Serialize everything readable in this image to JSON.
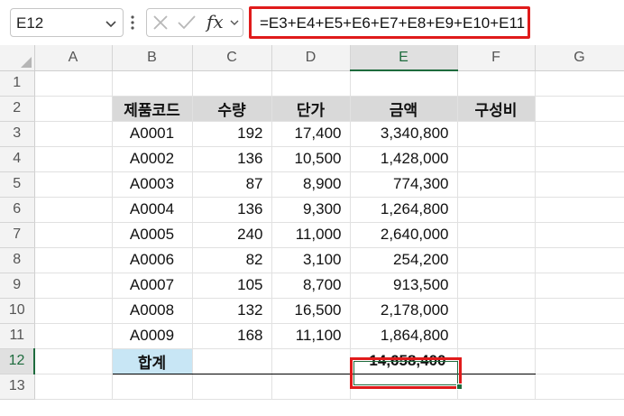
{
  "namebox": {
    "value": "E12"
  },
  "formula_bar": {
    "fx_label": "fx",
    "formula": "=E3+E4+E5+E6+E7+E8+E9+E10+E11"
  },
  "columns": [
    "A",
    "B",
    "C",
    "D",
    "E",
    "F",
    "G"
  ],
  "rows": [
    "1",
    "2",
    "3",
    "4",
    "5",
    "6",
    "7",
    "8",
    "9",
    "10",
    "11",
    "12",
    "13"
  ],
  "headers": {
    "code": "제품코드",
    "qty": "수량",
    "price": "단가",
    "amount": "금액",
    "ratio": "구성비"
  },
  "items": [
    {
      "code": "A0001",
      "qty": "192",
      "price": "17,400",
      "amount": "3,340,800"
    },
    {
      "code": "A0002",
      "qty": "136",
      "price": "10,500",
      "amount": "1,428,000"
    },
    {
      "code": "A0003",
      "qty": "87",
      "price": "8,900",
      "amount": "774,300"
    },
    {
      "code": "A0004",
      "qty": "136",
      "price": "9,300",
      "amount": "1,264,800"
    },
    {
      "code": "A0005",
      "qty": "240",
      "price": "11,000",
      "amount": "2,640,000"
    },
    {
      "code": "A0006",
      "qty": "82",
      "price": "3,100",
      "amount": "254,200"
    },
    {
      "code": "A0007",
      "qty": "105",
      "price": "8,700",
      "amount": "913,500"
    },
    {
      "code": "A0008",
      "qty": "132",
      "price": "16,500",
      "amount": "2,178,000"
    },
    {
      "code": "A0009",
      "qty": "168",
      "price": "11,100",
      "amount": "1,864,800"
    }
  ],
  "total": {
    "label": "합계",
    "amount": "14,658,400"
  },
  "colors": {
    "highlight_border": "#e01b1b",
    "selection": "#1e6b3d",
    "header_fill": "#d9d9d9",
    "total_label_fill": "#c8e6f5"
  }
}
